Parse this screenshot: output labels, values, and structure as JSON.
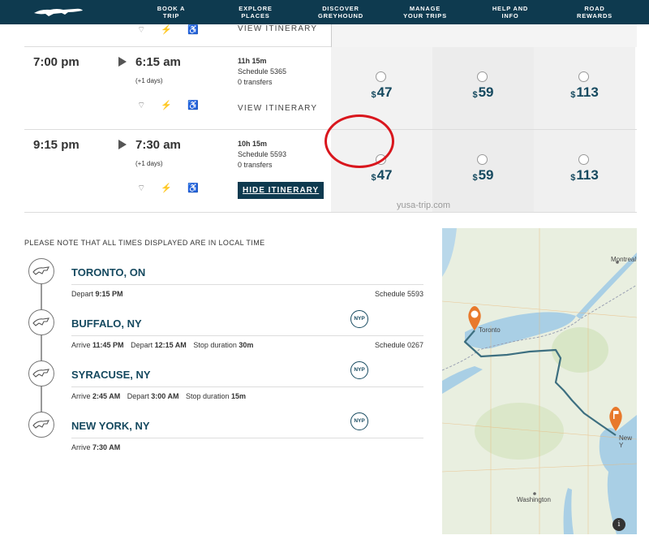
{
  "nav": {
    "items": [
      {
        "line1": "BOOK A",
        "line2": "TRIP"
      },
      {
        "line1": "EXPLORE",
        "line2": "PLACES"
      },
      {
        "line1": "DISCOVER",
        "line2": "GREYHOUND"
      },
      {
        "line1": "MANAGE",
        "line2": "YOUR TRIPS"
      },
      {
        "line1": "HELP AND",
        "line2": "INFO"
      },
      {
        "line1": "ROAD",
        "line2": "REWARDS"
      }
    ]
  },
  "partial_row": {
    "view_label": "VIEW ITINERARY",
    "icons": "⌔ ⚡ ♿"
  },
  "trips": [
    {
      "depart": "7:00 pm",
      "arrive": "6:15 am",
      "plus_days": "(+1 days)",
      "duration": "11h 15m",
      "schedule": "Schedule 5365",
      "transfers": "0 transfers",
      "itinerary_label": "VIEW ITINERARY",
      "amenities": "⌔ ⚡ ♿",
      "prices": [
        "47",
        "59",
        "113"
      ]
    },
    {
      "depart": "9:15 pm",
      "arrive": "7:30 am",
      "plus_days": "(+1 days)",
      "duration": "10h 15m",
      "schedule": "Schedule 5593",
      "transfers": "0 transfers",
      "itinerary_label": "HIDE ITINERARY",
      "amenities": "⌔ ⚡ ♿",
      "prices": [
        "47",
        "59",
        "113"
      ]
    }
  ],
  "currency": "$",
  "watermark": "yusa-trip.com",
  "itinerary": {
    "note": "PLEASE NOTE THAT ALL TIMES DISPLAYED ARE IN LOCAL TIME",
    "stops": [
      {
        "city": "TORONTO, ON",
        "details": [
          {
            "label": "Depart",
            "value": "9:15 PM"
          }
        ],
        "schedule": "Schedule 5593",
        "badge": ""
      },
      {
        "city": "BUFFALO, NY",
        "details": [
          {
            "label": "Arrive",
            "value": "11:45 PM"
          },
          {
            "label": "Depart",
            "value": "12:15 AM"
          },
          {
            "label": "Stop duration",
            "value": "30m"
          }
        ],
        "schedule": "Schedule 0267",
        "badge": "NYP"
      },
      {
        "city": "SYRACUSE, NY",
        "details": [
          {
            "label": "Arrive",
            "value": "2:45 AM"
          },
          {
            "label": "Depart",
            "value": "3:00 AM"
          },
          {
            "label": "Stop duration",
            "value": "15m"
          }
        ],
        "schedule": "",
        "badge": "NYP"
      },
      {
        "city": "NEW YORK, NY",
        "details": [
          {
            "label": "Arrive",
            "value": "7:30 AM"
          }
        ],
        "schedule": "",
        "badge": "NYP"
      }
    ]
  },
  "map": {
    "labels": {
      "montreal": "Montreal",
      "toronto": "Toronto",
      "new_york": "New Y",
      "washington": "Washington"
    },
    "info": "i"
  },
  "colors": {
    "brand_navy": "#0e3a4f",
    "price_blue": "#15495f",
    "highlight_red": "#d9161d",
    "route": "#3d6f80",
    "marker": "#e8792c"
  }
}
